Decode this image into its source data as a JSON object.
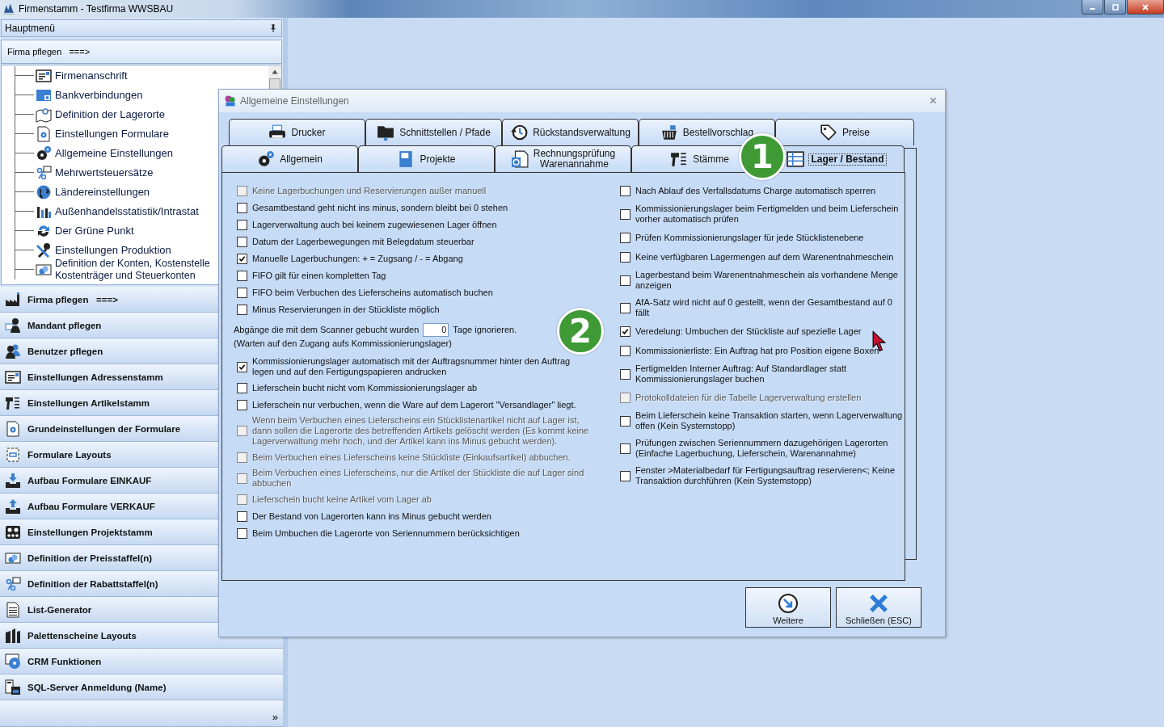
{
  "window": {
    "title": "Firmenstamm - Testfirma WWSBAU"
  },
  "main_menu": {
    "title": "Hauptmenü",
    "section": "Firma pflegen   ===>",
    "tree_items": [
      "Firmenanschrift",
      "Bankverbindungen",
      "Definition der Lagerorte",
      "Einstellungen Formulare",
      "Allgemeine Einstellungen",
      "Mehrwertsteuersätze",
      "Ländereinstellungen",
      "Außenhandelsstatistik/Intrastat",
      "Der Grüne Punkt",
      "Einstellungen Produktion",
      "Definition der Konten, Kostenstelle\nKostenträger und Steuerkonten"
    ],
    "nav_items": [
      "Firma pflegen   ===>",
      "Mandant pflegen",
      "Benutzer pflegen",
      "Einstellungen Adressenstamm",
      "Einstellungen Artikelstamm",
      "Grundeinstellungen der Formulare",
      "Formulare Layouts",
      "Aufbau Formulare EINKAUF",
      "Aufbau Formulare VERKAUF",
      "Einstellungen Projektstamm",
      "Definition der Preisstaffel(n)",
      "Definition der Rabattstaffel(n)",
      "List-Generator",
      "Palettenscheine Layouts",
      "CRM Funktionen",
      "SQL-Server Anmeldung (Name)"
    ],
    "more": "»"
  },
  "dialog": {
    "title": "Allgemeine Einstellungen",
    "close": "×",
    "tab_rows": [
      [
        {
          "label": "Drucker",
          "selected": false
        },
        {
          "label": "Schnittstellen / Pfade",
          "selected": false
        },
        {
          "label": "Rückstandsverwaltung",
          "selected": false
        },
        {
          "label": "Bestellvorschlag",
          "selected": false
        },
        {
          "label": "Preise",
          "selected": false
        }
      ],
      [
        {
          "label": "Allgemein",
          "selected": false
        },
        {
          "label": "Projekte",
          "selected": false
        },
        {
          "label": "Rechnungsprüfung\nWarenannahme",
          "selected": false
        },
        {
          "label": "Stämme",
          "selected": false
        },
        {
          "label": "Lager / Bestand",
          "selected": true
        }
      ]
    ],
    "left_options": [
      {
        "kind": "checkbox",
        "label": "Keine Lagerbuchungen und Reservierungen außer manuell",
        "checked": false,
        "disabled": true
      },
      {
        "kind": "checkbox",
        "label": "Gesamtbestand geht nicht ins minus, sondern bleibt bei 0 stehen",
        "checked": false,
        "disabled": false
      },
      {
        "kind": "checkbox",
        "label": "Lagerverwaltung auch bei keinem zugewiesenen Lager öffnen",
        "checked": false,
        "disabled": false
      },
      {
        "kind": "checkbox",
        "label": "Datum der Lagerbewegungen mit Belegdatum steuerbar",
        "checked": false,
        "disabled": false
      },
      {
        "kind": "checkbox",
        "label": "Manuelle Lagerbuchungen: + = Zugsang / - = Abgang",
        "checked": true,
        "disabled": false
      },
      {
        "kind": "checkbox",
        "label": "FIFO gilt für einen kompletten Tag",
        "checked": false,
        "disabled": false
      },
      {
        "kind": "checkbox",
        "label": "FIFO beim Verbuchen des Lieferscheins automatisch buchen",
        "checked": false,
        "disabled": false
      },
      {
        "kind": "checkbox",
        "label": "Minus Reservierungen in der Stückliste möglich",
        "checked": false,
        "disabled": false
      },
      {
        "kind": "number",
        "label": "Abgänge die mit dem Scanner gebucht wurden",
        "value": "0",
        "suffix": "Tage ignorieren.",
        "note": "(Warten auf den Zugang aufs Kommissionierungslager)"
      },
      {
        "kind": "checkbox",
        "label": "Kommissionierungslager automatisch mit der Auftragsnummer hinter den Auftrag legen und auf den Fertigungspapieren andrucken",
        "checked": true,
        "disabled": false
      },
      {
        "kind": "checkbox",
        "label": "Lieferschein bucht nicht vom Kommissionierungslager ab",
        "checked": false,
        "disabled": false
      },
      {
        "kind": "checkbox",
        "label": "Lieferschein nur verbuchen, wenn die Ware auf dem Lagerort \"Versandlager\" liegt.",
        "checked": false,
        "disabled": false
      },
      {
        "kind": "checkbox",
        "label": "Wenn beim Verbuchen eines Lieferscheins ein Stücklistenartikel nicht auf Lager ist, dann sollen die Lagerorte des betreffenden Artikels gelöscht werden (Es kommt keine Lagerverwaltung mehr hoch, und der Artikel kann ins Minus gebucht werden).",
        "checked": false,
        "disabled": true
      },
      {
        "kind": "checkbox",
        "label": "Beim Verbuchen eines Lieferscheins keine Stückliste (Einkaufsartikel) abbuchen.",
        "checked": false,
        "disabled": true
      },
      {
        "kind": "checkbox",
        "label": "Beim Verbuchen eines Lieferscheins, nur die Artikel der Stückliste die auf Lager sind abbuchen",
        "checked": false,
        "disabled": true
      },
      {
        "kind": "checkbox",
        "label": "Lieferschein bucht keine Artikel vom Lager ab",
        "checked": false,
        "disabled": true
      },
      {
        "kind": "checkbox",
        "label": "Der Bestand von Lagerorten kann ins Minus gebucht werden",
        "checked": false,
        "disabled": false
      },
      {
        "kind": "checkbox",
        "label": "Beim Umbuchen die Lagerorte von Seriennummern berücksichtigen",
        "checked": false,
        "disabled": false
      }
    ],
    "right_options": [
      {
        "label": "Nach Ablauf des Verfallsdatums Charge automatisch sperren",
        "checked": false,
        "disabled": false
      },
      {
        "label": "Kommissionierungslager beim Fertigmelden und beim Lieferschein vorher automatisch prüfen",
        "checked": false,
        "disabled": false
      },
      {
        "label": "Prüfen Kommissionierungslager für jede Stücklistenebene",
        "checked": false,
        "disabled": false
      },
      {
        "label": "Keine verfügbaren Lagermengen auf dem Warenentnahmeschein",
        "checked": false,
        "disabled": false
      },
      {
        "label": "Lagerbestand beim Warenentnahmeschein als vorhandene Menge anzeigen",
        "checked": false,
        "disabled": false
      },
      {
        "label": "AfA-Satz wird nicht auf 0 gestellt, wenn der Gesamtbestand auf 0 fällt",
        "checked": false,
        "disabled": false
      },
      {
        "label": "Veredelung: Umbuchen der Stückliste auf spezielle Lager",
        "checked": true,
        "disabled": false
      },
      {
        "label": "Kommissionierliste: Ein Auftrag hat pro Position eigene Boxen",
        "checked": false,
        "disabled": false
      },
      {
        "label": "Fertigmelden Interner Auftrag: Auf Standardlager statt Kommissionierungslager buchen",
        "checked": false,
        "disabled": false
      },
      {
        "label": "Protokolldateien für die Tabelle Lagerverwaltung erstellen",
        "checked": false,
        "disabled": true
      },
      {
        "label": "Beim Lieferschein keine Transaktion starten, wenn Lagerverwaltung offen (Kein Systemstopp)",
        "checked": false,
        "disabled": false
      },
      {
        "label": "Prüfungen zwischen Seriennummern dazugehörigen Lagerorten (Einfache Lagerbuchung, Lieferschein, Warenannahme)",
        "checked": false,
        "disabled": false
      },
      {
        "label": "Fenster >Materialbedarf für Fertigungsauftrag reservieren<; Keine Transaktion durchführen (Kein Systemstopp)",
        "checked": false,
        "disabled": false
      }
    ],
    "buttons": [
      "Weitere",
      "Schließen (ESC)"
    ]
  },
  "callouts": [
    "1",
    "2"
  ]
}
